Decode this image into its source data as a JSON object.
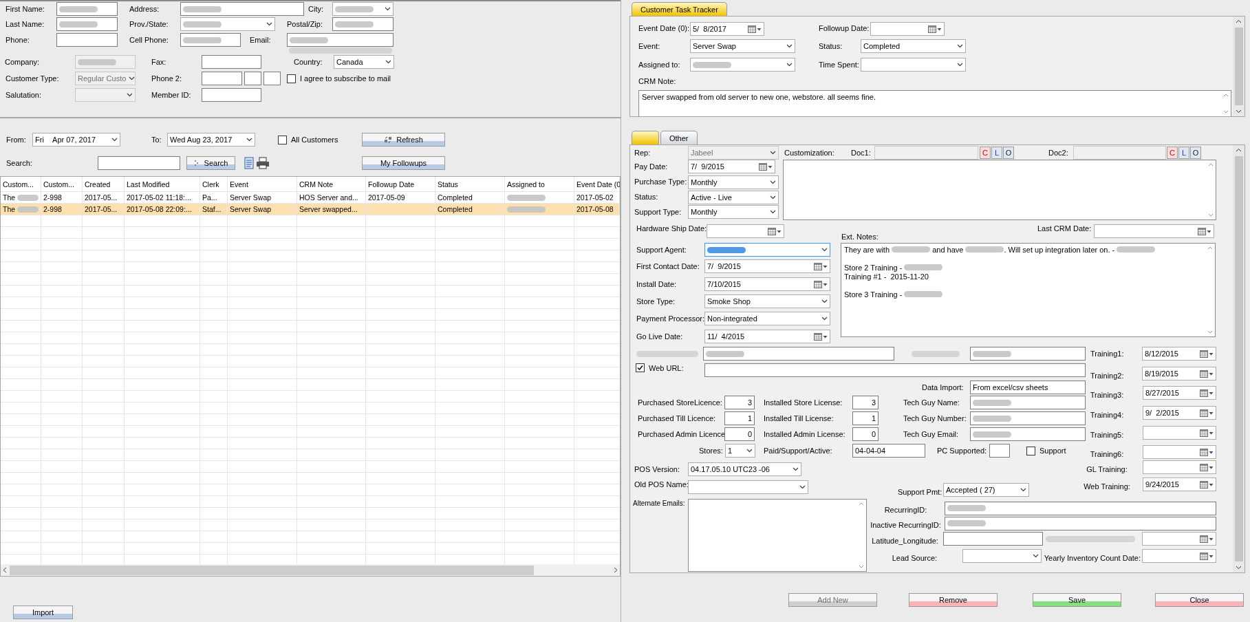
{
  "customer": {
    "first_name": {
      "label": "First Name:",
      "redacted": true
    },
    "last_name": {
      "label": "Last Name:",
      "redacted": true
    },
    "phone": {
      "label": "Phone:"
    },
    "address": {
      "label": "Address:",
      "redacted": true
    },
    "prov_state": {
      "label": "Prov./State:",
      "redacted": true
    },
    "cell_phone": {
      "label": "Cell Phone:",
      "redacted": true
    },
    "city": {
      "label": "City:",
      "redacted": true
    },
    "postal_zip": {
      "label": "Postal/Zip:",
      "redacted": true
    },
    "email": {
      "label": "Email:",
      "redacted": true
    },
    "email_consent": {
      "redacted": true
    },
    "company": {
      "label": "Company:",
      "redacted": true,
      "disabled": true
    },
    "fax": {
      "label": "Fax:"
    },
    "country": {
      "label": "Country:",
      "value": "Canada"
    },
    "customer_type": {
      "label": "Customer Type:",
      "value": "Regular Custo",
      "disabled": true
    },
    "phone_2": {
      "label": "Phone 2:"
    },
    "subscribe": {
      "label": "I agree to subscribe to mail",
      "checked": false
    },
    "salutation": {
      "label": "Salutation:",
      "disabled": true
    },
    "member_id": {
      "label": "Member ID:"
    }
  },
  "filter": {
    "from": {
      "label": "From:",
      "day": "Fri",
      "date": "Apr 07, 2017"
    },
    "to": {
      "label": "To:",
      "value": "Wed Aug 23, 2017"
    },
    "all_customers": {
      "label": "All Customers",
      "checked": false
    },
    "refresh_button": "Refresh",
    "search": {
      "label": "Search:"
    },
    "search_button": "Search",
    "followups_button": "My Followups"
  },
  "table": {
    "columns": [
      "Custom...",
      "Custom...",
      "Created",
      "Last Modified",
      "Clerk",
      "Event",
      "CRM Note",
      "Followup Date",
      "Status",
      "Assigned to",
      "Event Date (0"
    ],
    "rows": [
      {
        "selected": false,
        "cells": [
          {
            "text": "The",
            "redacted": true
          },
          "2-998",
          "2017-05...",
          "2017-05-02 11:18:...",
          "Pa...",
          "Server Swap",
          "HOS Server and...",
          "2017-05-09",
          "Completed",
          {
            "redacted": true
          },
          "2017-05-02"
        ]
      },
      {
        "selected": true,
        "cells": [
          {
            "text": "The",
            "redacted": true
          },
          "2-998",
          "2017-05...",
          "2017-05-08 22:09:...",
          "Staf...",
          "Server Swap",
          "Server swapped...",
          null,
          "Completed",
          {
            "redacted": true
          },
          "2017-05-08"
        ]
      }
    ]
  },
  "import_button": "Import",
  "task_tracker": {
    "tab": {
      "label": "Customer Task Tracker",
      "selected": true
    },
    "event_date": {
      "label": "Event Date (0):",
      "value": "5/  8/2017"
    },
    "followup_date": {
      "label": "Followup Date:"
    },
    "event": {
      "label": "Event:",
      "value": "Server Swap"
    },
    "status": {
      "label": "Status:",
      "value": "Completed"
    },
    "assigned_to": {
      "label": "Assigned to:",
      "redacted": true
    },
    "time_spent": {
      "label": "Time Spent:"
    },
    "crm_note": {
      "label": "CRM Note:",
      "value": "Server swapped from old server to new one, webstore. all seems fine."
    }
  },
  "details": {
    "tabs": [
      {
        "selected": true
      },
      {
        "label": "Other",
        "selected": false
      }
    ],
    "rep": {
      "label": "Rep:",
      "value": "Jabeel",
      "disabled": true
    },
    "customization": {
      "label": "Customization:"
    },
    "doc1": {
      "label": "Doc1:",
      "disabled": true,
      "buttons": [
        {
          "label": "C",
          "kind": "clear"
        },
        {
          "label": "L",
          "kind": "load"
        },
        {
          "label": "O",
          "kind": "open"
        }
      ]
    },
    "doc2": {
      "label": "Doc2:",
      "disabled": true,
      "buttons": [
        {
          "label": "C",
          "kind": "clear"
        },
        {
          "label": "L",
          "kind": "load"
        },
        {
          "label": "O",
          "kind": "open"
        }
      ]
    },
    "pay_date": {
      "label": "Pay Date:",
      "value": "7/  9/2015"
    },
    "purchase_type": {
      "label": "Purchase Type:",
      "value": "Monthly"
    },
    "status": {
      "label": "Status:",
      "value": "Active - Live"
    },
    "support_type": {
      "label": "Support Type:",
      "value": "Monthly"
    },
    "hardware_ship_date": {
      "label": "Hardware Ship Date:"
    },
    "ext_notes": {
      "label": "Ext. Notes:",
      "paragraphs": [
        [
          [
            {
              "text": "They are with "
            },
            {
              "redacted": true
            },
            {
              "text": " and have "
            },
            {
              "redacted": true
            },
            {
              "text": ". Will set up integration later on. - "
            },
            {
              "redacted": true
            }
          ]
        ],
        [
          [
            {
              "text": "Store 2 Training - "
            },
            {
              "redacted": true
            }
          ],
          [
            {
              "text": "Training #1 -  2015-11-20"
            }
          ]
        ],
        [
          [
            {
              "text": "Store 3 Training - "
            },
            {
              "redacted": true
            }
          ]
        ]
      ]
    },
    "last_crm_date": {
      "label": "Last CRM Date:"
    },
    "support_agent": {
      "label": "Support Agent:",
      "redacted": true,
      "focused": true
    },
    "first_contact_date": {
      "label": "First Contact Date:",
      "value": "7/  9/2015"
    },
    "install_date": {
      "label": "Install Date:",
      "value": "7/10/2015"
    },
    "store_type": {
      "label": "Store Type:",
      "value": "Smoke Shop"
    },
    "payment_processor": {
      "label": "Payment Processor:",
      "value": "Non-integrated"
    },
    "go_live_date": {
      "label": "Go Live Date:",
      "value": "11/  4/2015"
    },
    "blurred_email": {
      "label_redacted": true,
      "redacted": true
    },
    "blurred_ftp": {
      "label_redacted": true,
      "redacted": true
    },
    "web_url": {
      "label": "Web URL:",
      "checked": true
    },
    "trainings": [
      {
        "label": "Training1:",
        "value": "8/12/2015"
      },
      {
        "label": "Training2:",
        "value": "8/19/2015"
      },
      {
        "label": "Training3:",
        "value": "8/27/2015"
      },
      {
        "label": "Training4:",
        "value": "9/  2/2015"
      },
      {
        "label": "Training5:"
      },
      {
        "label": "Training6:"
      },
      {
        "label": "GL Training:"
      },
      {
        "label": "Web Training:",
        "value": "9/24/2015"
      }
    ],
    "data_import": {
      "label": "Data Import:",
      "value": "From excel/csv sheets"
    },
    "purchased_store": {
      "label": "Purchased StoreLicence:",
      "value": "3"
    },
    "installed_store": {
      "label": "Installed Store License:",
      "value": "3"
    },
    "tech_name": {
      "label": "Tech Guy Name:",
      "redacted": true
    },
    "purchased_till": {
      "label": "Purchased Till Licence:",
      "value": "1"
    },
    "installed_till": {
      "label": "Installed Till License:",
      "value": "1"
    },
    "tech_number": {
      "label": "Tech Guy Number:",
      "redacted": true
    },
    "purchased_admin": {
      "label": "Purchased Admin Licence",
      "value": "0"
    },
    "installed_admin": {
      "label": "Installed Admin License:",
      "value": "0"
    },
    "tech_email": {
      "label": "Tech Guy Email:",
      "redacted": true
    },
    "stores": {
      "label": "Stores:",
      "value": "1"
    },
    "paid_support_active": {
      "label": "Paid/Support/Active:",
      "value": "04-04-04"
    },
    "pc_supported": {
      "label": "PC Supported:"
    },
    "support": {
      "label": "Support",
      "checked": false
    },
    "pos_version": {
      "label": "POS Version:",
      "value": "04.17.05.10 UTC23 -06"
    },
    "old_pos_name": {
      "label": "Old POS Name:"
    },
    "support_pmt": {
      "label": "Support Pmt:",
      "value": "Accepted ( 27)"
    },
    "alternate_emails": {
      "label": "Alternate Emails:"
    },
    "recurring_id": {
      "label": "RecurringID:",
      "redacted": true
    },
    "inactive_recurring_id": {
      "label": "Inactive RecurringID:",
      "redacted": true
    },
    "lat_long": {
      "label": "Latitude_Longitude:"
    },
    "blurred_date": {
      "label_redacted": true
    },
    "lead_source": {
      "label": "Lead Source:"
    },
    "yearly_inventory": {
      "label": "Yearly Inventory Count Date:"
    }
  },
  "actions": [
    {
      "label": "Add New",
      "kind": "add",
      "disabled": true
    },
    {
      "label": "Remove",
      "kind": "remove",
      "disabled": false
    },
    {
      "label": "Save",
      "kind": "save",
      "disabled": false
    },
    {
      "label": "Close",
      "kind": "close",
      "disabled": false
    }
  ]
}
